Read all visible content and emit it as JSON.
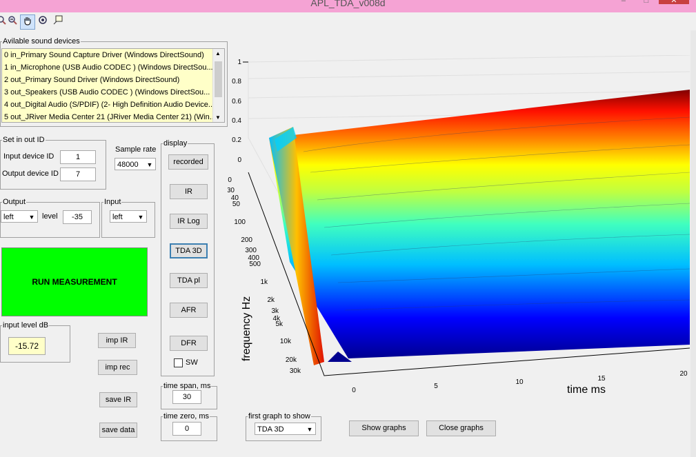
{
  "window": {
    "title": "APL_TDA_v008d",
    "minimize": "–",
    "maximize": "□",
    "close": "✕"
  },
  "toolbar": {
    "tools": [
      "zoom-in-icon",
      "zoom-out-icon",
      "pan-icon",
      "rotate-icon",
      "data-cursor-icon"
    ]
  },
  "devices": {
    "legend": "Avilable sound devices",
    "items": [
      "0 in_Primary Sound Capture Driver (Windows DirectSound)",
      "1 in_Microphone (USB Audio CODEC ) (Windows DirectSou...",
      "2 out_Primary Sound Driver (Windows DirectSound)",
      "3 out_Speakers (USB Audio CODEC ) (Windows DirectSou...",
      "4 out_Digital Audio (S/PDIF) (2- High Definition Audio Device...",
      "5 out_JRiver Media Center 21 (JRiver Media Center 21) (Win..."
    ]
  },
  "setio": {
    "legend": "Set in out ID",
    "input_label": "Input device ID",
    "input_value": "1",
    "output_label": "Output device ID",
    "output_value": "7"
  },
  "samplerate": {
    "label": "Sample rate",
    "value": "48000"
  },
  "output": {
    "legend": "Output",
    "channel": "left",
    "level_label": "level",
    "level_value": "-35"
  },
  "input": {
    "legend": "Input",
    "channel": "left"
  },
  "run": {
    "label": "RUN MEASUREMENT",
    "color": "#00ff00"
  },
  "inputlevel": {
    "legend": "input level dB",
    "value": "-15.72"
  },
  "display": {
    "legend": "display",
    "buttons": {
      "recorded": "recorded",
      "ir": "IR",
      "irlog": "IR Log",
      "tda3d": "TDA 3D",
      "tdapl": "TDA pl",
      "afr": "AFR",
      "dfr": "DFR"
    },
    "sw_label": "SW"
  },
  "actions": {
    "imp_ir": "imp IR",
    "imp_rec": "imp rec",
    "save_ir": "save IR",
    "save_data": "save data"
  },
  "timespan": {
    "legend": "time span, ms",
    "value": "30"
  },
  "timezero": {
    "legend": "time zero, ms",
    "value": "0"
  },
  "firstgraph": {
    "legend": "first graph to show",
    "value": "TDA 3D"
  },
  "graphs": {
    "show": "Show graphs",
    "close": "Close graphs"
  },
  "plot": {
    "z_ticks": [
      "1",
      "0.8",
      "0.6",
      "0.4",
      "0.2",
      "0"
    ],
    "freq_ticks": [
      "20",
      "30",
      "40",
      "50",
      "100",
      "200",
      "300",
      "400",
      "500",
      "1k",
      "2k",
      "3k",
      "4k",
      "5k",
      "10k",
      "20k",
      "30k"
    ],
    "time_ticks": [
      "0",
      "5",
      "10",
      "15",
      "20"
    ],
    "freq_label": "frequency   Hz",
    "time_label": "time   ms"
  }
}
